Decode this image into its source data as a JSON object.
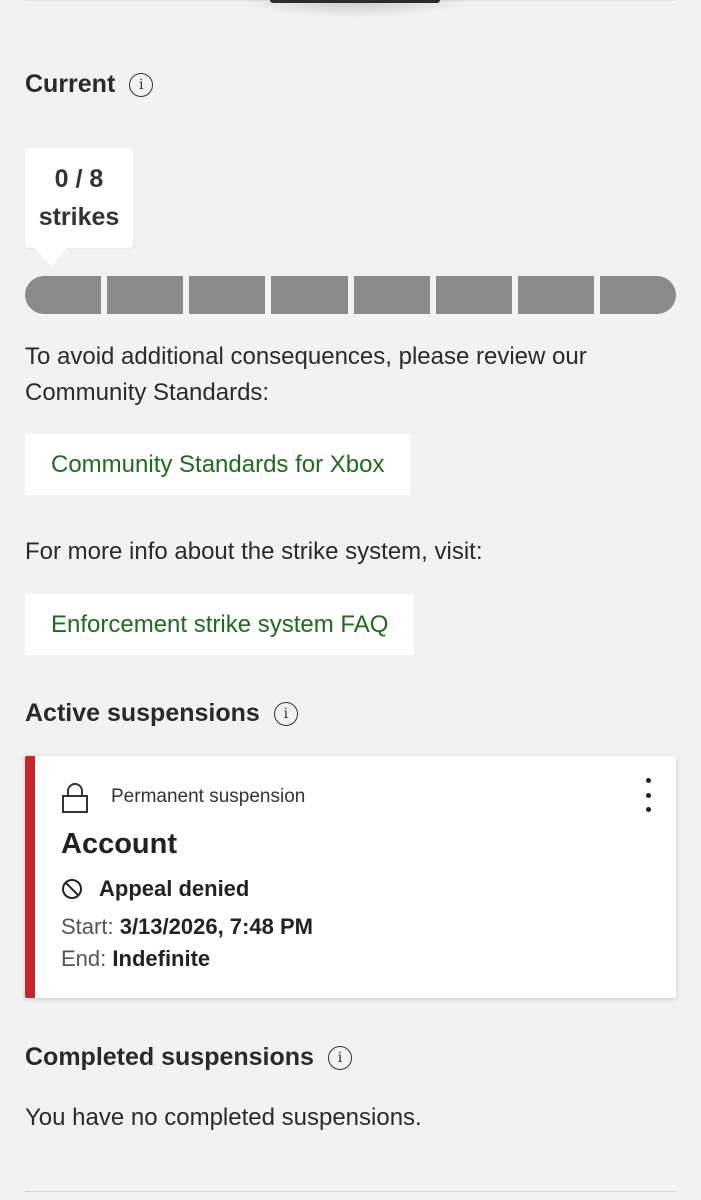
{
  "current": {
    "title": "Current",
    "strikes_count": "0 / 8",
    "strikes_label": "strikes",
    "strikes_value": 0,
    "strikes_max": 8,
    "review_text": "To avoid additional consequences, please review our Community Standards:",
    "community_link": "Community Standards for Xbox",
    "faq_text": "For more info about the strike system, visit:",
    "faq_link": "Enforcement strike system FAQ"
  },
  "active": {
    "title": "Active suspensions",
    "card": {
      "type": "Permanent suspension",
      "name": "Account",
      "status": "Appeal denied",
      "start_label": "Start:",
      "start_value": "3/13/2026, 7:48 PM",
      "end_label": "End:",
      "end_value": "Indefinite",
      "accent_color": "#c4262e"
    }
  },
  "completed": {
    "title": "Completed suspensions",
    "empty_text": "You have no completed suspensions."
  },
  "icons": {
    "info": "info-icon",
    "lock": "lock-icon",
    "blocked": "blocked-icon",
    "more": "more-options-icon"
  },
  "colors": {
    "link": "#1e6b1e",
    "strike_segment": "#8b8a8a",
    "background": "#f2f2f2"
  }
}
